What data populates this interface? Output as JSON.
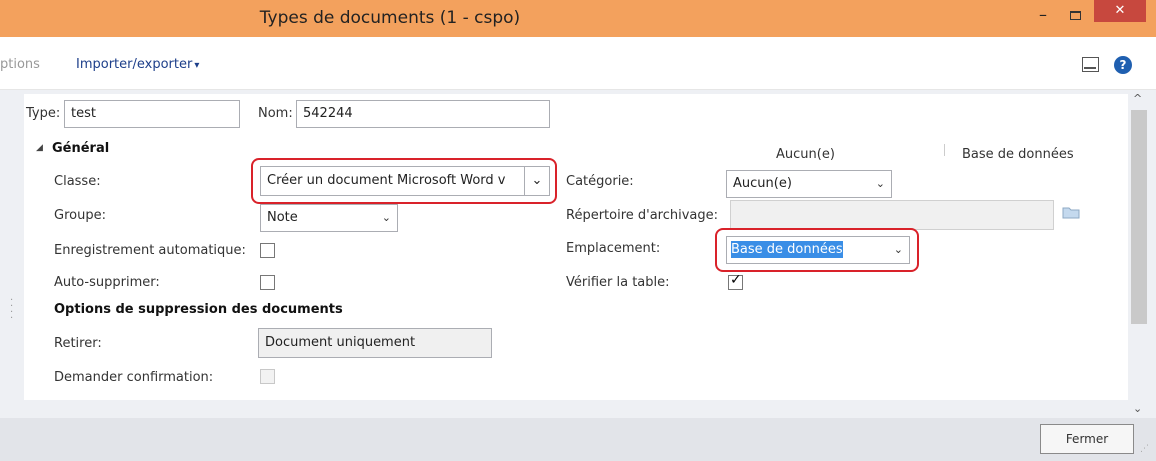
{
  "window": {
    "title": "Types de documents (1 - cspo)",
    "min_glyph": "–",
    "close_glyph": "✕",
    "accent": "#f3a15d",
    "close_color": "#c7483e"
  },
  "menubar": {
    "options_label": "ptions",
    "import_label": "Importer/exporter",
    "caret": "▾",
    "help_glyph": "?"
  },
  "header": {
    "type_label": "Type:",
    "type_value": "test",
    "nom_label": "Nom:",
    "nom_value": "542244"
  },
  "general": {
    "section_label": "Général",
    "collapse_glyph": "◢",
    "col_header_1": "Aucun(e)",
    "col_header_2": "Base de données",
    "classe_label": "Classe:",
    "classe_value": "Créer un document Microsoft Word v",
    "groupe_label": "Groupe:",
    "groupe_value": "Note",
    "enreg_label": "Enregistrement automatique:",
    "autosupp_label": "Auto-supprimer:",
    "categorie_label": "Catégorie:",
    "categorie_value": "Aucun(e)",
    "repertoire_label": "Répertoire d'archivage:",
    "repertoire_value": "",
    "emplacement_label": "Emplacement:",
    "emplacement_value": "Base de données",
    "verifier_label": "Vérifier la table:",
    "verifier_checked": true
  },
  "suppression": {
    "section_label": "Options de suppression des documents",
    "retirer_label": "Retirer:",
    "retirer_value": "Document uniquement",
    "confirm_label": "Demander confirmation:"
  },
  "footer": {
    "close_button": "Fermer"
  },
  "icons": {
    "select_arrow": "⌄",
    "scroll_up": "^",
    "scroll_down": "⌄"
  }
}
